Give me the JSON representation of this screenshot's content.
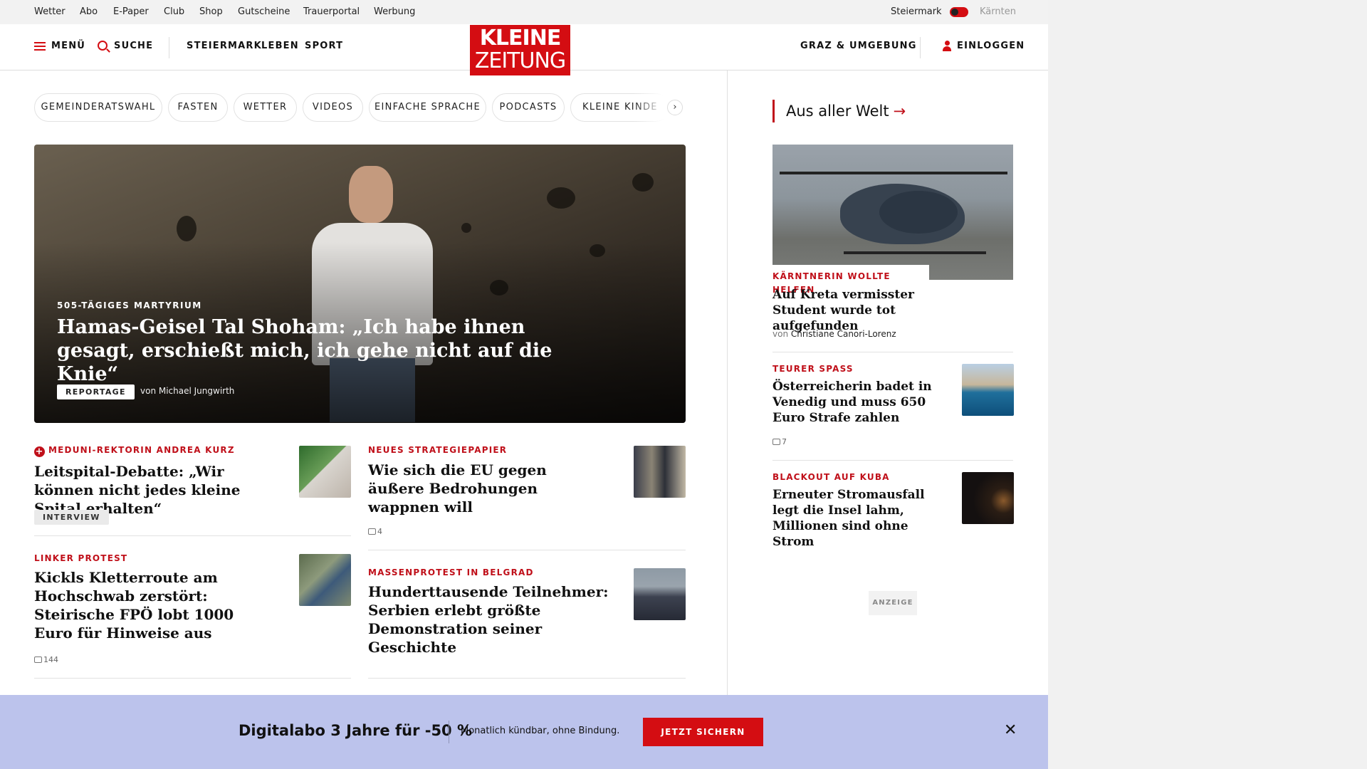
{
  "topbar": {
    "links": [
      "Wetter",
      "Abo",
      "E-Paper",
      "Club",
      "Shop",
      "Gutscheine",
      "Trauerportal",
      "Werbung"
    ],
    "region_active": "Steiermark",
    "region_other": "Kärnten"
  },
  "header": {
    "menu_label": "MENÜ",
    "search_label": "SUCHE",
    "nav": [
      "STEIERMARK",
      "LEBEN",
      "SPORT"
    ],
    "logo_line1": "KLEINE",
    "logo_line2": "ZEITUNG",
    "location": "GRAZ & UMGEBUNG",
    "login_label": "EINLOGGEN"
  },
  "pills": [
    "GEMEINDERATSWAHL",
    "FASTEN",
    "WETTER",
    "VIDEOS",
    "EINFACHE SPRACHE",
    "PODCASTS",
    "KLEINE KINDE"
  ],
  "pills_next": "›",
  "hero": {
    "kicker": "505-TÄGIGES MARTYRIUM",
    "title": "Hamas-Geisel Tal Shoham: „Ich habe ihnen gesagt, erschießt mich, ich gehe nicht auf die Knie“",
    "tag": "REPORTAGE",
    "author": "von Michael Jungwirth"
  },
  "articles": [
    {
      "kicker": "MEDUNI-REKTORIN ANDREA KURZ",
      "title": "Leitspital-Debatte: „Wir können nicht jedes kleine Spital erhalten“",
      "tag": "INTERVIEW"
    },
    {
      "kicker": "NEUES STRATEGIEPAPIER",
      "title": "Wie sich die EU gegen äußere Bedrohungen wappnen will",
      "comments": "4"
    },
    {
      "kicker": "LINKER PROTEST",
      "title": "Kickls Kletterroute am Hochschwab zerstört: Steirische FPÖ lobt 1000 Euro für Hinweise aus",
      "comments": "144"
    },
    {
      "kicker": "MASSENPROTEST IN BELGRAD",
      "title": "Hunderttausende Teilnehmer: Serbien erlebt größte Demonstration seiner Geschichte"
    }
  ],
  "sidebar": {
    "section_title": "Aus aller Welt",
    "section_arrow": "→",
    "featured": {
      "kicker": "KÄRNTNERIN WOLLTE HELFEN",
      "title": "Auf Kreta vermisster Student wurde tot aufgefunden",
      "byline_prefix": "von",
      "byline_name": "Christiane Canori-Lorenz"
    },
    "items": [
      {
        "kicker": "TEURER SPASS",
        "title": "Österreicherin badet in Venedig und muss 650 Euro Strafe zahlen",
        "comments": "7"
      },
      {
        "kicker": "BLACKOUT AUF KUBA",
        "title": "Erneuter Stromausfall legt die Insel lahm, Millionen sind ohne Strom"
      }
    ],
    "ad_label": "ANZEIGE"
  },
  "promo": {
    "headline": "Digitalabo 3 Jahre für -50 %",
    "subtext": "Monatlich kündbar, ohne Bindung.",
    "cta": "JETZT SICHERN",
    "close": "✕"
  },
  "colors": {
    "brand_red": "#d40d12",
    "kicker_red": "#c0101a",
    "promo_bg": "#bcc3ec"
  }
}
